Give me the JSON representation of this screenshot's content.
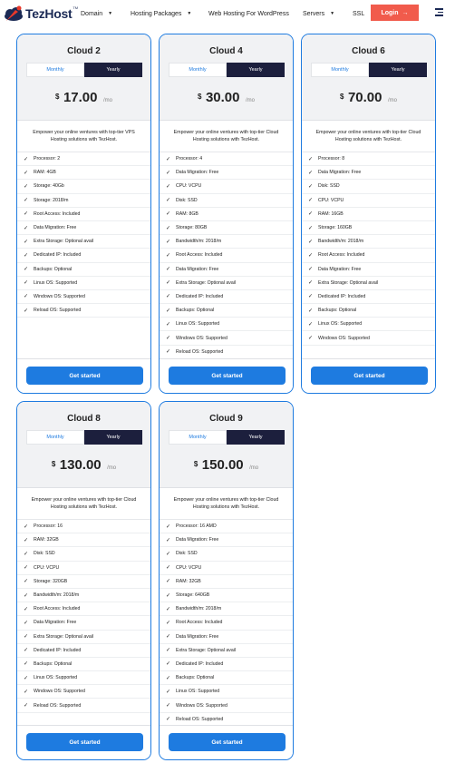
{
  "header": {
    "logo_text": "TezHost",
    "logo_tm": "TM",
    "nav": [
      {
        "label": "Domain",
        "has_caret": true
      },
      {
        "label": "Hosting Packages",
        "has_caret": true
      },
      {
        "label": "Web Hosting For WordPress",
        "has_caret": false
      },
      {
        "label": "Servers",
        "has_caret": true
      },
      {
        "label": "SSL",
        "has_caret": false
      }
    ],
    "login_label": "Login",
    "login_arrow": "→"
  },
  "plans": [
    {
      "name": "Cloud 2",
      "monthly_label": "Monthly",
      "yearly_label": "Yearly",
      "currency": "$",
      "price": "17.00",
      "period": "/mo",
      "description": "Empower your online ventures with top-tier VPS Hosting solutions with TezHost.",
      "features": [
        "Processor: 2",
        "RAM: 4GB",
        "Storage: 40Gb",
        "Storage: 2018/m",
        "Root Access: Included",
        "Data Migration: Free",
        "Extra Storage: Optional avail",
        "Dedicated IP: Included",
        "Backups: Optional",
        "Linux OS: Supported",
        "Windows OS: Supported",
        "Reload OS: Supported"
      ],
      "button_label": "Get started"
    },
    {
      "name": "Cloud 4",
      "monthly_label": "Monthly",
      "yearly_label": "Yearly",
      "currency": "$",
      "price": "30.00",
      "period": "/mo",
      "description": "Empower your online ventures with top-tier Cloud Hosting solutions with TezHost.",
      "features": [
        "Processor: 4",
        "Data Migration: Free",
        "CPU: VCPU",
        "Disk: SSD",
        "RAM: 8GB",
        "Storage: 80GB",
        "Bandwidth/m: 2018/m",
        "Root Access: Included",
        "Data Migration: Free",
        "Extra Storage: Optional avail",
        "Dedicated IP: Included",
        "Backups: Optional",
        "Linux OS: Supported",
        "Windows OS: Supported",
        "Reload OS: Supported"
      ],
      "button_label": "Get started"
    },
    {
      "name": "Cloud 6",
      "monthly_label": "Monthly",
      "yearly_label": "Yearly",
      "currency": "$",
      "price": "70.00",
      "period": "/mo",
      "description": "Empower your online ventures with top-tier Cloud Hosting solutions with TezHost.",
      "features": [
        "Processor: 8",
        "Data Migration: Free",
        "Disk: SSD",
        "CPU: VCPU",
        "RAM: 16GB",
        "Storage: 160GB",
        "Bandwidth/m: 2018/m",
        "Root Access: Included",
        "Data Migration: Free",
        "Extra Storage: Optional avail",
        "Dedicated IP: Included",
        "Backups: Optional",
        "Linux OS: Supported",
        "Windows OS: Supported"
      ],
      "button_label": "Get started"
    },
    {
      "name": "Cloud 8",
      "monthly_label": "Monthly",
      "yearly_label": "Yearly",
      "currency": "$",
      "price": "130.00",
      "period": "/mo",
      "description": "Empower your online ventures with top-tier Cloud Hosting solutions with TezHost.",
      "features": [
        "Processor: 16",
        "RAM: 32GB",
        "Disk: SSD",
        "CPU: VCPU",
        "Storage: 320GB",
        "Bandwidth/m: 2018/m",
        "Root Access: Included",
        "Data Migration: Free",
        "Extra Storage: Optional avail",
        "Dedicated IP: Included",
        "Backups: Optional",
        "Linux OS: Supported",
        "Windows OS: Supported",
        "Reload OS: Supported"
      ],
      "button_label": "Get started"
    },
    {
      "name": "Cloud 9",
      "monthly_label": "Monthly",
      "yearly_label": "Yearly",
      "currency": "$",
      "price": "150.00",
      "period": "/mo",
      "description": "Empower your online ventures with top-tier Cloud Hosting solutions with TezHost.",
      "features": [
        "Processor: 16 AMD",
        "Data Migration: Free",
        "Disk: SSD",
        "CPU: VCPU",
        "RAM: 32GB",
        "Storage: 640GB",
        "Bandwidth/m: 2018/m",
        "Root Access: Included",
        "Data Migration: Free",
        "Extra Storage: Optional avail",
        "Dedicated IP: Included",
        "Backups: Optional",
        "Linux OS: Supported",
        "Windows OS: Supported",
        "Reload OS: Supported"
      ],
      "button_label": "Get started"
    }
  ],
  "colors": {
    "accent": "#1e7be0",
    "dark": "#1c1f3d",
    "login": "#f15b4c"
  }
}
